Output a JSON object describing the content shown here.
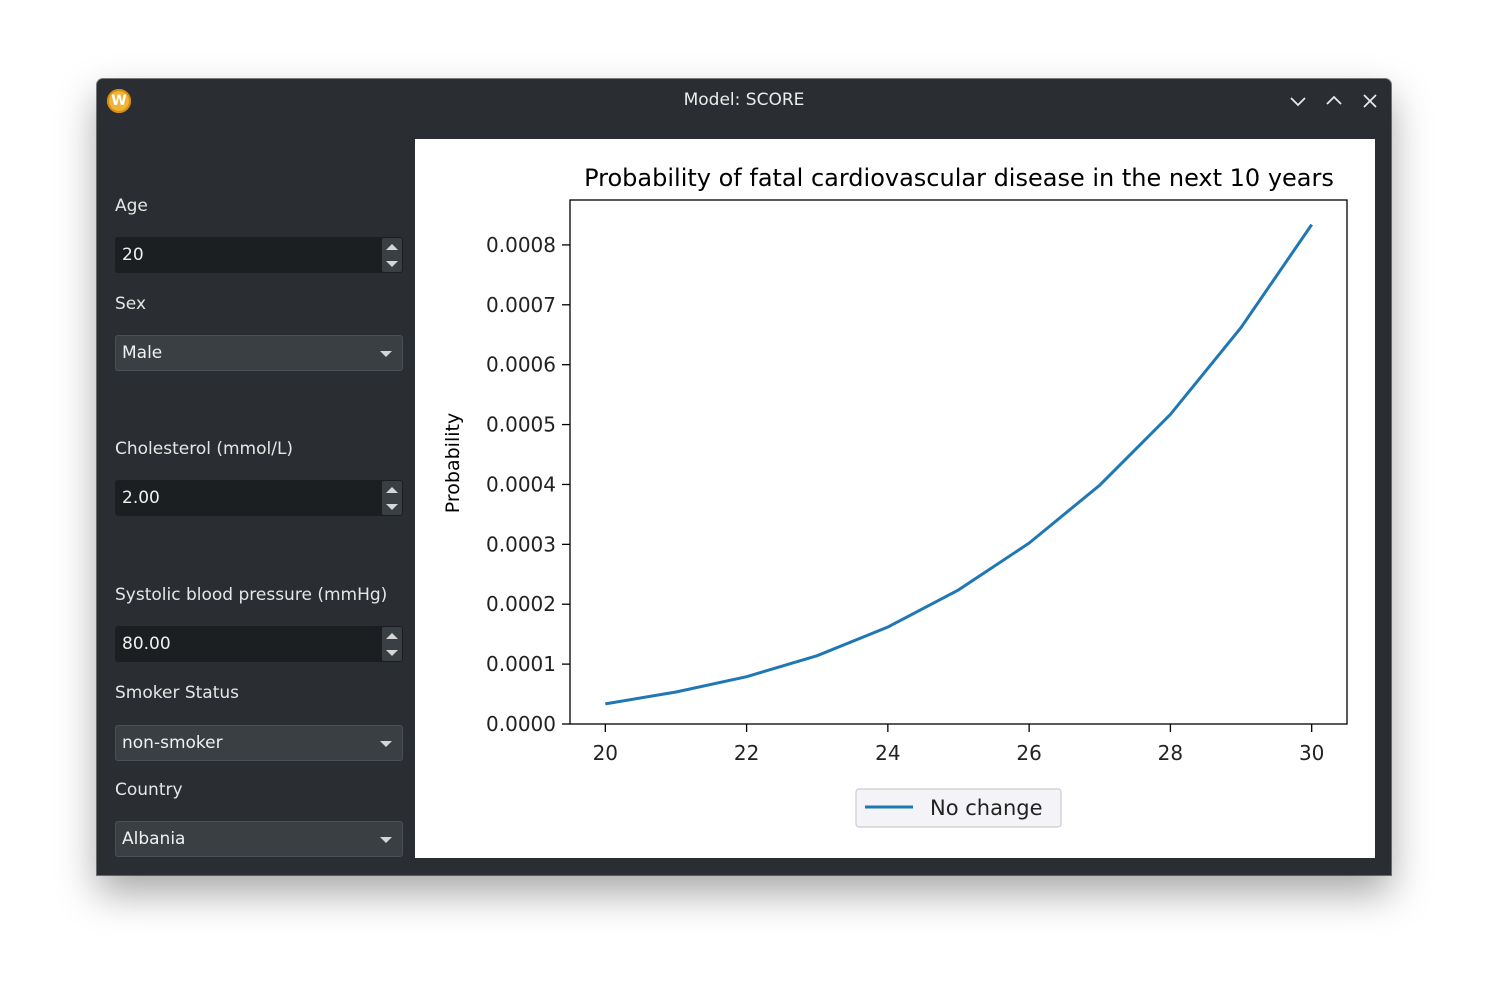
{
  "window": {
    "title": "Model: SCORE",
    "app_icon_letter": "W"
  },
  "sidebar": {
    "age": {
      "label": "Age",
      "value": "20"
    },
    "sex": {
      "label": "Sex",
      "value": "Male"
    },
    "cholesterol": {
      "label": "Cholesterol (mmol/L)",
      "value": "2.00"
    },
    "sbp": {
      "label": "Systolic blood pressure (mmHg)",
      "value": "80.00"
    },
    "smoker": {
      "label": "Smoker Status",
      "value": "non-smoker"
    },
    "country": {
      "label": "Country",
      "value": "Albania"
    }
  },
  "chart_data": {
    "type": "line",
    "title": "Probability of fatal cardiovascular disease in the next 10 years",
    "xlabel": "",
    "ylabel": "Probability",
    "xlim": [
      19.5,
      30.5
    ],
    "ylim": [
      0.0,
      0.000875
    ],
    "xticks": [
      20,
      22,
      24,
      26,
      28,
      30
    ],
    "xtick_labels": [
      "20",
      "22",
      "24",
      "26",
      "28",
      "30"
    ],
    "yticks": [
      0.0,
      0.0001,
      0.0002,
      0.0003,
      0.0004,
      0.0005,
      0.0006,
      0.0007,
      0.0008
    ],
    "ytick_labels": [
      "0.0000",
      "0.0001",
      "0.0002",
      "0.0003",
      "0.0004",
      "0.0005",
      "0.0006",
      "0.0007",
      "0.0008"
    ],
    "grid": false,
    "legend": "lower-center",
    "x": [
      20,
      21,
      22,
      23,
      24,
      25,
      26,
      27,
      28,
      29,
      30
    ],
    "series": [
      {
        "name": "No change",
        "color": "#1f77b4",
        "values": [
          3.35e-05,
          5.35e-05,
          7.9e-05,
          0.000114,
          0.000162,
          0.000224,
          0.000302,
          0.000399,
          0.000517,
          0.000662,
          0.000834
        ]
      }
    ]
  }
}
